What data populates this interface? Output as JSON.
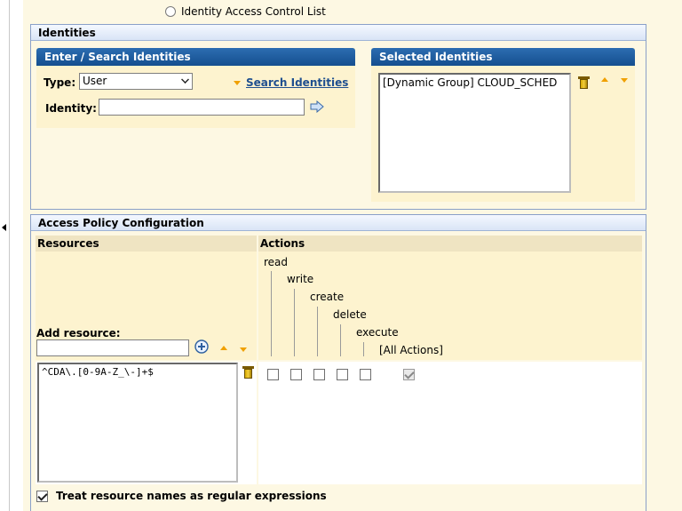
{
  "top_radio": {
    "label": "Identity Access Control List",
    "selected": false
  },
  "identities_panel": {
    "title": "Identities",
    "search": {
      "title": "Enter / Search Identities",
      "type_label": "Type:",
      "type_value": "User",
      "search_link": "Search Identities",
      "identity_label": "Identity:",
      "identity_value": ""
    },
    "selected": {
      "title": "Selected Identities",
      "items": [
        "[Dynamic Group] CLOUD_SCHED"
      ]
    }
  },
  "access_policy": {
    "title": "Access Policy Configuration",
    "resources_header": "Resources",
    "actions_header": "Actions",
    "add_resource_label": "Add resource:",
    "add_resource_value": "",
    "actions": [
      "read",
      "write",
      "create",
      "delete",
      "execute",
      "[All Actions]"
    ],
    "resources": [
      "^CDA\\.[0-9A-Z_\\-]+$"
    ],
    "action_checks": [
      false,
      false,
      false,
      false,
      false,
      true
    ],
    "regex_checkbox": {
      "label": "Treat resource names as regular expressions",
      "checked": true
    }
  }
}
